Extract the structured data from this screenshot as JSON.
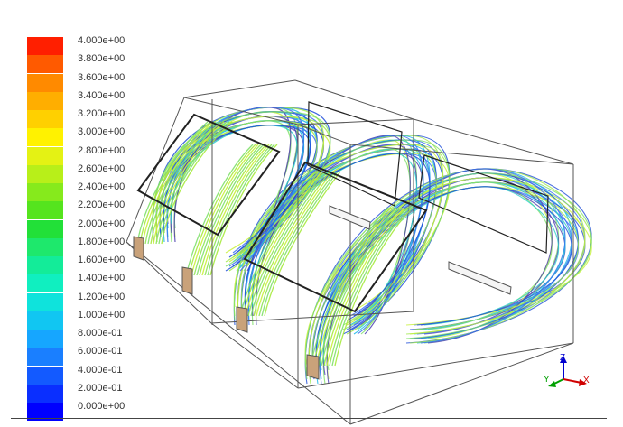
{
  "legend": {
    "colormap": [
      "#0000ff",
      "#0a2fff",
      "#135aff",
      "#1a7fff",
      "#16a6ff",
      "#11c6f2",
      "#0fe3dc",
      "#10efc0",
      "#13ec99",
      "#1ee86c",
      "#22e038",
      "#55e41e",
      "#86ea1c",
      "#b8ef19",
      "#e4f214",
      "#fff200",
      "#ffd000",
      "#ffae00",
      "#ff8a00",
      "#ff5a00",
      "#ff1f00"
    ],
    "ticks": [
      "4.000e+00",
      "3.800e+00",
      "3.600e+00",
      "3.400e+00",
      "3.200e+00",
      "3.000e+00",
      "2.800e+00",
      "2.600e+00",
      "2.400e+00",
      "2.200e+00",
      "2.000e+00",
      "1.800e+00",
      "1.600e+00",
      "1.400e+00",
      "1.200e+00",
      "1.000e+00",
      "8.000e-01",
      "6.000e-01",
      "4.000e-01",
      "2.000e-01",
      "0.000e+00"
    ]
  },
  "triad": {
    "x": "X",
    "y": "Y",
    "z": "Z",
    "x_color": "#d00000",
    "y_color": "#00a000",
    "z_color": "#0000d0"
  },
  "scene": {
    "box_color": "#555555",
    "panel_color": "#222222",
    "streamline_palette": [
      "#1f4ed8",
      "#3a6ff0",
      "#19b7e6",
      "#2ad0c8",
      "#4b3fb0",
      "#7fe06a",
      "#c8f03a",
      "#a0e84a"
    ]
  }
}
